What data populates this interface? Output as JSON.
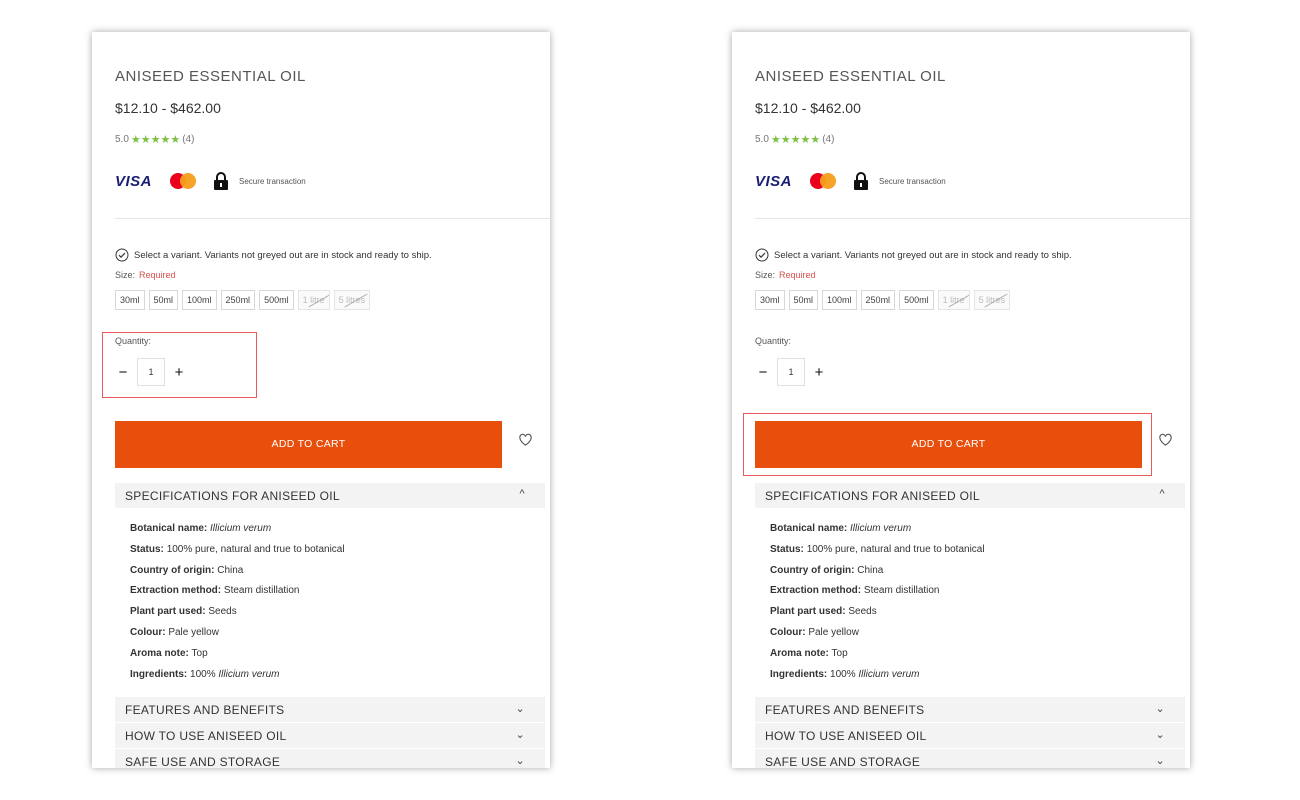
{
  "product": {
    "title": "ANISEED ESSENTIAL OIL",
    "price": "$12.10 - $462.00",
    "rating": "5.0",
    "stars": "★★★★★",
    "review_count": "(4)",
    "payments": {
      "visa": "VISA",
      "secure_text": "Secure transaction"
    }
  },
  "variant": {
    "message": "Select a variant. Variants not greyed out are in stock and ready to ship.",
    "size_label": "Size:",
    "size_required": "Required",
    "sizes": [
      {
        "label": "30ml",
        "available": true
      },
      {
        "label": "50ml",
        "available": true
      },
      {
        "label": "100ml",
        "available": true
      },
      {
        "label": "250ml",
        "available": true
      },
      {
        "label": "500ml",
        "available": true
      },
      {
        "label": "1 litre",
        "available": false
      },
      {
        "label": "5 litres",
        "available": false
      }
    ]
  },
  "quantity": {
    "label": "Quantity:",
    "value": "1",
    "minus": "−",
    "plus": "+"
  },
  "cart": {
    "label": "ADD TO CART"
  },
  "accordions": {
    "specifications": {
      "label": "SPECIFICATIONS FOR ANISEED OIL",
      "chevron": "^"
    },
    "features": {
      "label": "FEATURES AND BENEFITS",
      "chevron": "⌄"
    },
    "how_to_use": {
      "label": "HOW TO USE ANISEED OIL",
      "chevron": "⌄"
    },
    "safe_use": {
      "label": "SAFE USE AND STORAGE",
      "chevron": "⌄"
    }
  },
  "specs": {
    "botanical": {
      "label": "Botanical name:",
      "value": "Illicium verum"
    },
    "status": {
      "label": "Status:",
      "value": "100% pure, natural and true to botanical"
    },
    "origin": {
      "label": "Country of origin:",
      "value": "China"
    },
    "extraction": {
      "label": "Extraction method:",
      "value": "Steam distillation"
    },
    "part": {
      "label": "Plant part used:",
      "value": "Seeds"
    },
    "colour": {
      "label": "Colour:",
      "value": "Pale yellow"
    },
    "aroma": {
      "label": "Aroma note:",
      "value": "Top"
    },
    "ingredients": {
      "label": "Ingredients:",
      "value_prefix": "100%",
      "value_italic": "Illicium verum"
    }
  },
  "colors": {
    "accent": "#e84e0c",
    "highlight": "#e85a5a",
    "stars": "#7bc043",
    "required": "#d9534f"
  }
}
